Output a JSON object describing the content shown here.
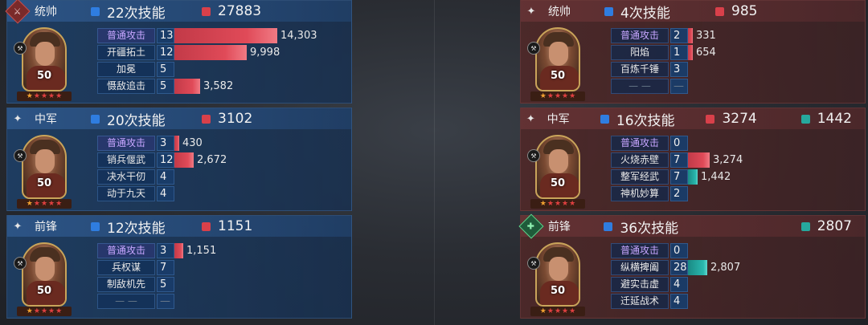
{
  "left_team": [
    {
      "role": "统帅",
      "role_icon": "sword-badge-icon",
      "skill_count_label": "22次技能",
      "damage": "27883",
      "heal": null,
      "level": "50",
      "stars": 5,
      "skills": [
        {
          "name": "普通攻击",
          "count": "13",
          "damage": "14,303",
          "bar": 0.95,
          "special": true
        },
        {
          "name": "开疆拓土",
          "count": "12",
          "damage": "9,998",
          "bar": 0.67
        },
        {
          "name": "加冕",
          "count": "5",
          "damage": "",
          "bar": 0
        },
        {
          "name": "慑敌追击",
          "count": "5",
          "damage": "3,582",
          "bar": 0.24
        }
      ]
    },
    {
      "role": "中军",
      "role_icon": "diamond-icon",
      "skill_count_label": "20次技能",
      "damage": "3102",
      "heal": null,
      "level": "50",
      "stars": 5,
      "skills": [
        {
          "name": "普通攻击",
          "count": "3",
          "damage": "430",
          "bar": 0.03,
          "special": true
        },
        {
          "name": "销兵偃武",
          "count": "12",
          "damage": "2,672",
          "bar": 0.18
        },
        {
          "name": "决水干仞",
          "count": "4",
          "damage": "",
          "bar": 0
        },
        {
          "name": "动于九天",
          "count": "4",
          "damage": "",
          "bar": 0
        }
      ]
    },
    {
      "role": "前锋",
      "role_icon": "diamond-icon",
      "skill_count_label": "12次技能",
      "damage": "1151",
      "heal": null,
      "level": "50",
      "stars": 5,
      "skills": [
        {
          "name": "普通攻击",
          "count": "3",
          "damage": "1,151",
          "bar": 0.08,
          "special": true
        },
        {
          "name": "兵权谋",
          "count": "7",
          "damage": "",
          "bar": 0
        },
        {
          "name": "制敌机先",
          "count": "5",
          "damage": "",
          "bar": 0
        },
        {
          "name": "— —",
          "count": "—",
          "damage": "",
          "bar": 0,
          "empty": true
        }
      ]
    }
  ],
  "right_team": [
    {
      "role": "统帅",
      "role_icon": "diamond-icon",
      "skill_count_label": "4次技能",
      "damage": "985",
      "heal": null,
      "level": "50",
      "stars": 5,
      "skills": [
        {
          "name": "普通攻击",
          "count": "2",
          "damage": "331",
          "bar": 0.02,
          "special": true
        },
        {
          "name": "阳焰",
          "count": "1",
          "damage": "654",
          "bar": 0.04
        },
        {
          "name": "百炼千锤",
          "count": "3",
          "damage": "",
          "bar": 0
        },
        {
          "name": "— —",
          "count": "—",
          "damage": "",
          "bar": 0,
          "empty": true
        }
      ]
    },
    {
      "role": "中军",
      "role_icon": "diamond-icon",
      "skill_count_label": "16次技能",
      "damage": "3274",
      "heal": "1442",
      "level": "50",
      "stars": 5,
      "skills": [
        {
          "name": "普通攻击",
          "count": "0",
          "damage": "",
          "bar": 0,
          "special": true
        },
        {
          "name": "火烧赤壁",
          "count": "7",
          "damage": "3,274",
          "bar": 0.2
        },
        {
          "name": "整军经武",
          "count": "7",
          "damage": "1,442",
          "bar": 0.09,
          "teal": true
        },
        {
          "name": "神机妙算",
          "count": "2",
          "damage": "",
          "bar": 0
        }
      ]
    },
    {
      "role": "前锋",
      "role_icon": "heal-badge-icon",
      "skill_count_label": "36次技能",
      "damage": null,
      "heal": "2807",
      "level": "50",
      "stars": 5,
      "skills": [
        {
          "name": "普通攻击",
          "count": "0",
          "damage": "",
          "bar": 0,
          "special": true
        },
        {
          "name": "纵横捭阖",
          "count": "28",
          "damage": "2,807",
          "bar": 0.18,
          "teal": true
        },
        {
          "name": "避实击虚",
          "count": "4",
          "damage": "",
          "bar": 0
        },
        {
          "name": "迁延战术",
          "count": "4",
          "damage": "",
          "bar": 0
        }
      ]
    }
  ],
  "colors": {
    "damage": "#d8404a",
    "skill": "#2f7de0",
    "heal": "#26a89d",
    "normal_attack_text": "#c7a6ff"
  }
}
